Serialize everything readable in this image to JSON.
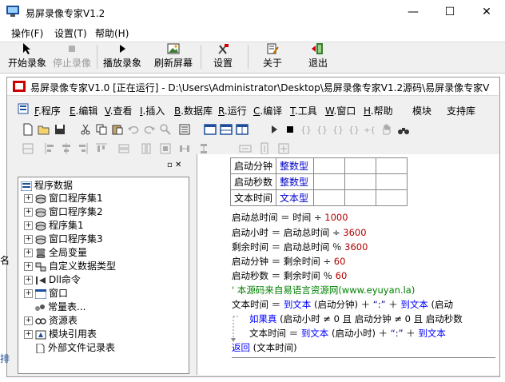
{
  "window": {
    "title": "易屏录像专家V1.2",
    "controls": {
      "minimize": "—",
      "maximize": "☐",
      "close": "✕"
    }
  },
  "menu": [
    "操作(F)",
    "设置(T)",
    "帮助(H)"
  ],
  "toolbar": {
    "start": "开始录象",
    "stop": "停止录像",
    "play": "播放录象",
    "refresh": "刷新屏幕",
    "settings": "设置",
    "about": "关于",
    "exit": "退出"
  },
  "inner": {
    "title": "易屏录像专家V1.0 [正在运行] - D:\\Users\\Administrator\\Desktop\\易屏录像专家V1.2源码\\易屏录像专家V",
    "menu": [
      {
        "key": "F",
        "label": ".程序"
      },
      {
        "key": "E",
        "label": ".编辑"
      },
      {
        "key": "V",
        "label": ".查看"
      },
      {
        "key": "I",
        "label": ".插入"
      },
      {
        "key": "B",
        "label": ".数据库"
      },
      {
        "key": "R",
        "label": ".运行"
      },
      {
        "key": "C",
        "label": ".编译"
      },
      {
        "key": "T",
        "label": ".工具"
      },
      {
        "key": "W",
        "label": ".窗口"
      },
      {
        "key": "H",
        "label": ".帮助"
      },
      {
        "key": "",
        "label": "模块"
      },
      {
        "key": "",
        "label": "支持库"
      }
    ],
    "panel_controls": "▫ ✕"
  },
  "tree": [
    {
      "label": "程序数据",
      "expander": "",
      "indent": 0
    },
    {
      "label": "窗口程序集1",
      "expander": "+",
      "indent": 1
    },
    {
      "label": "窗口程序集2",
      "expander": "+",
      "indent": 1
    },
    {
      "label": "程序集1",
      "expander": "+",
      "indent": 1
    },
    {
      "label": "窗口程序集3",
      "expander": "+",
      "indent": 1
    },
    {
      "label": "全局变量",
      "expander": "+",
      "indent": 1
    },
    {
      "label": "自定义数据类型",
      "expander": "+",
      "indent": 1
    },
    {
      "label": "Dll命令",
      "expander": "+",
      "indent": 1
    },
    {
      "label": "窗口",
      "expander": "+",
      "indent": 1
    },
    {
      "label": "常量表...",
      "expander": "",
      "indent": 1
    },
    {
      "label": "资源表",
      "expander": "+",
      "indent": 1
    },
    {
      "label": "模块引用表",
      "expander": "+",
      "indent": 1
    },
    {
      "label": "外部文件记录表",
      "expander": "",
      "indent": 1
    }
  ],
  "var_table": [
    {
      "name": "启动分钟",
      "type": "整数型"
    },
    {
      "name": "启动秒数",
      "type": "整数型"
    },
    {
      "name": "文本时间",
      "type": "文本型"
    }
  ],
  "code": {
    "l1a": "启动总时间 ＝ 时间 ÷ ",
    "l1n": "1000",
    "l2a": "启动小时 ＝ 启动总时间 ÷ ",
    "l2n": "3600",
    "l3a": "剩余时间 ＝ 启动总时间 ％ ",
    "l3n": "3600",
    "l4a": "启动分钟 ＝ 剩余时间 ÷ ",
    "l4n": "60",
    "l5a": "启动秒数 ＝ 剩余时间 ％ ",
    "l5n": "60",
    "l6": "' 本源码来自易语言资源网(www.eyuyan.la)",
    "l7a": "文本时间 ＝ ",
    "l7b": "到文本",
    "l7c": " (启动分钟) ＋ ",
    "l7d": "“:”",
    "l7e": " ＋ ",
    "l7f": "到文本",
    "l7g": " (启动",
    "l8a": "如果真",
    "l8b": " (启动小时 ≠ 0 且 启动分钟 ≠ 0 且 启动秒数",
    "l9a": "文本时间 ＝ ",
    "l9b": "到文本",
    "l9c": " (启动小时) ＋ ",
    "l9d": "“:”",
    "l9e": " ＋ ",
    "l9f": "到文本",
    "l10a": "返回",
    "l10b": " (文本时间)"
  },
  "edge_fragments": {
    "left1": "名",
    "left2": "排"
  }
}
